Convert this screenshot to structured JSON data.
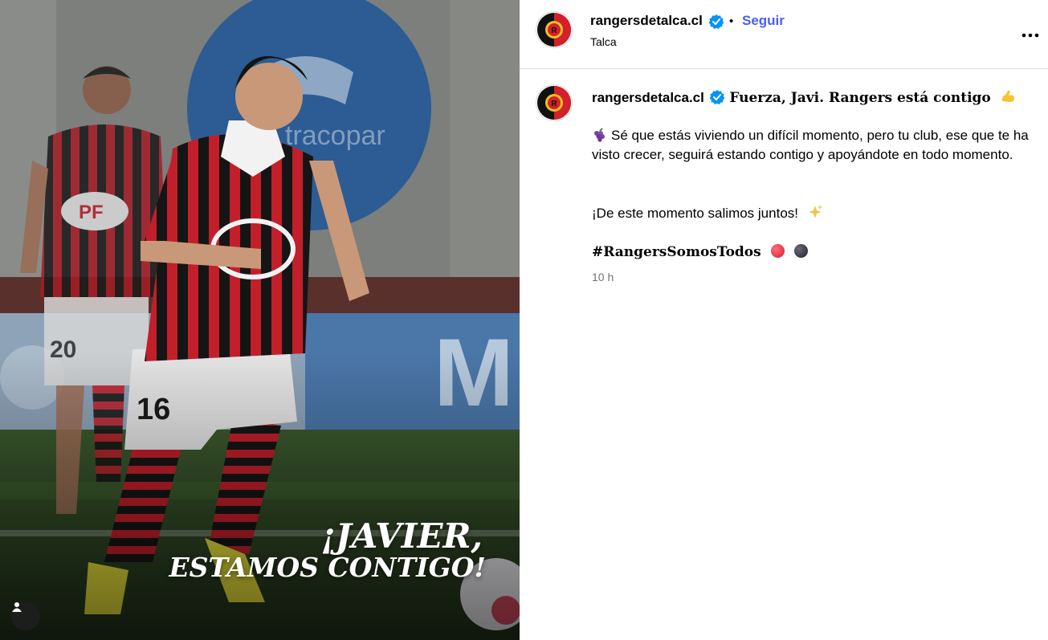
{
  "post": {
    "overlay_line1": "¡JAVIER,",
    "overlay_line2": "ESTAMOS CONTIGO!",
    "jersey_number": "16",
    "sponsor_text": "PF"
  },
  "header": {
    "username": "rangersdetalca.cl",
    "separator": "•",
    "follow_label": "Seguir",
    "location": "Talca"
  },
  "caption": {
    "username": "rangersdetalca.cl",
    "headline": "Fuerza, Javi. Rangers está contigo",
    "paragraph1": "Sé que estás viviendo un difícil momento, pero tu club, ese que te ha visto crecer, seguirá estando contigo y apoyándote en todo momento.",
    "paragraph2": "¡De este momento salimos juntos!",
    "hashtag": "#RangersSomosTodos",
    "timestamp": "10 h"
  },
  "icons": {
    "verified": "verified-badge-icon",
    "more": "more-options-icon",
    "tag": "user-tag-icon",
    "grape": "grapes-emoji",
    "sparkles": "sparkles-emoji",
    "muscle": "flexed-biceps-emoji"
  },
  "colors": {
    "brand_red": "#d3202b",
    "brand_black": "#111111",
    "follow_blue": "#4a5df9",
    "verified_blue": "#0095f6",
    "timestamp_gray": "#737373"
  }
}
